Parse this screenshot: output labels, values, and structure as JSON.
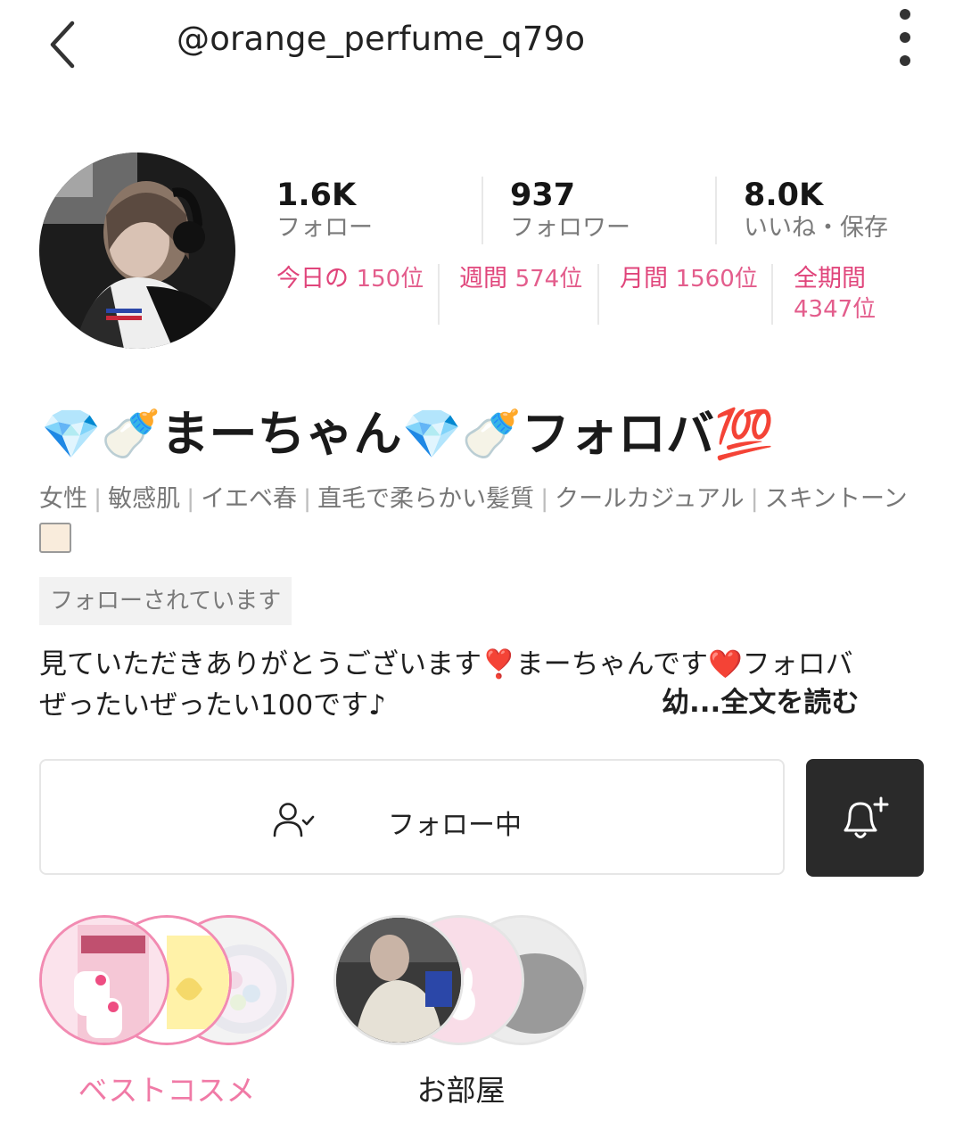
{
  "header": {
    "username": "@orange_perfume_q79o",
    "back_icon": "chevron-left-icon",
    "more_icon": "more-vertical-icon"
  },
  "profile": {
    "display_name": "💎🍼まーちゃん💎🍼フォロバ💯",
    "stats": [
      {
        "value": "1.6K",
        "label": "フォロー"
      },
      {
        "value": "937",
        "label": "フォロワー"
      },
      {
        "value": "8.0K",
        "label": "いいね・保存"
      }
    ],
    "rankings": [
      {
        "period": "今日の",
        "rank": "150位"
      },
      {
        "period": "週間",
        "rank": "574位"
      },
      {
        "period": "月間",
        "rank": "1560位"
      },
      {
        "period": "全期間",
        "rank": "4347位"
      }
    ],
    "tags": [
      "女性",
      "敏感肌",
      "イエベ春",
      "直毛で柔らかい髪質",
      "クールカジュアル",
      "スキントーン"
    ],
    "skin_tone_color": "#f9ecdc",
    "follows_you": "フォローされています",
    "bio_line1": "見ていただきありがとうございます❣️まーちゃんです❤️フォロバ",
    "bio_line2": "ぜったいぜったい100です♪",
    "read_more": "幼...全文を読む"
  },
  "actions": {
    "following_label": "フォロー中",
    "following_icon": "user-check-icon",
    "bell_icon": "bell-plus-icon"
  },
  "highlights": [
    {
      "label": "ベストコスメ",
      "color": "#f07aa6"
    },
    {
      "label": "お部屋",
      "color": "#222222"
    }
  ],
  "colors": {
    "accent_pink": "#e0457b",
    "dark_button": "#2a2a2a"
  }
}
